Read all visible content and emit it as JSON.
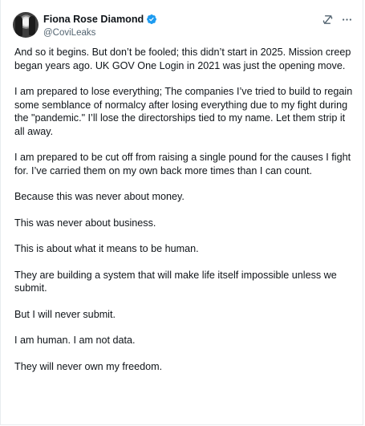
{
  "author": {
    "display_name": "Fiona Rose Diamond",
    "handle": "@CoviLeaks",
    "verified_color": "#1d9bf0"
  },
  "header_icons": [
    "grok-icon",
    "more-icon"
  ],
  "paragraphs": [
    "And so it begins. But don’t be fooled; this didn’t start in 2025. Mission creep began years ago. UK GOV One Login in 2021 was just the opening move.",
    "I am prepared to lose everything; The companies I’ve tried to build to regain some semblance of normalcy after losing everything due to my fight during the \"pandemic.\" I’ll lose the directorships tied to my name. Let them strip it all away.",
    "I am prepared to be cut off from raising a single pound for the causes I fight for. I’ve carried them on my own back more times than I can count.",
    "Because this was never about money.",
    "This was never about business.",
    "This is about what it means to be human.",
    "They are building a system that will make life itself impossible unless we submit.",
    "But I will never submit.",
    "I am human. I am not data.",
    "They will never own my freedom."
  ]
}
